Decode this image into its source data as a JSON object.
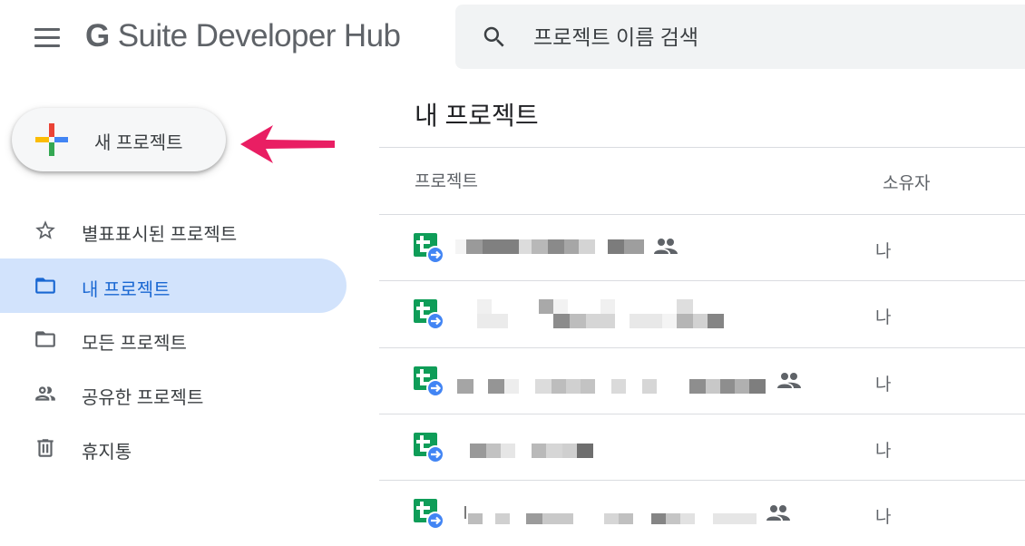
{
  "header": {
    "logo_g": "G",
    "logo_rest": " Suite Developer Hub",
    "search_placeholder": "프로젝트 이름 검색"
  },
  "new_project_button": {
    "label": "새 프로젝트"
  },
  "sidebar": {
    "items": [
      {
        "label": "별표표시된 프로젝트",
        "icon": "star-icon"
      },
      {
        "label": "내 프로젝트",
        "icon": "folder-icon",
        "active": true
      },
      {
        "label": "모든 프로젝트",
        "icon": "folder-icon"
      },
      {
        "label": "공유한 프로젝트",
        "icon": "people-icon"
      },
      {
        "label": "휴지통",
        "icon": "trash-icon"
      }
    ]
  },
  "main": {
    "title": "내 프로젝트",
    "columns": {
      "project": "프로젝트",
      "owner": "소유자"
    },
    "rows": [
      {
        "name": "[blurred]",
        "owner": "나",
        "shared": true
      },
      {
        "name": "[blurred]",
        "owner": "나",
        "shared": false
      },
      {
        "name": "[blurred]",
        "owner": "나",
        "shared": true
      },
      {
        "name": "[blurred]",
        "owner": "나",
        "shared": false
      },
      {
        "name": "[blurred]",
        "owner": "나",
        "shared": true
      }
    ]
  },
  "colors": {
    "active_bg": "#d2e3fc",
    "active_text": "#1967d2",
    "arrow": "#e91e63",
    "script_green": "#0f9d58",
    "script_blue": "#4285f4"
  }
}
